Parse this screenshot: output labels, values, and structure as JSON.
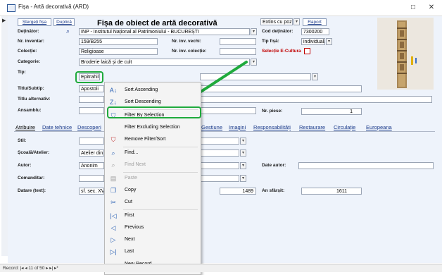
{
  "window": {
    "title": "Fișa - Artă decorativă (ARD)",
    "minimize": "□",
    "close": "✕"
  },
  "toolbar": {
    "delete_label": "Ștergeți fișa",
    "duplicate_label": "Duplică",
    "form_title": "Fișa de obiect de artă decorativă",
    "view_mode": "Extins cu poză",
    "report_label": "Raport"
  },
  "fields": {
    "detinator_label": "Deținător:",
    "detinator_value": "INP - Institutul Național al Patrimoniului - BUCUREȘTI",
    "cod_detinator_label": "Cod deținător:",
    "cod_detinator_value": "7300200",
    "nr_inventar_label": "Nr. inventar:",
    "nr_inventar_value": "159/B255",
    "nr_inv_vechi_label": "Nr. inv. vechi:",
    "nr_inv_vechi_value": "",
    "tip_fisa_label": "Tip fișă:",
    "tip_fisa_value": "individuală",
    "colectie_label": "Colecție:",
    "colectie_value": "Religioase",
    "nr_inv_colectie_label": "Nr. inv. colecție:",
    "nr_inv_colectie_value": "",
    "selectie_label": "Selecție E-Cultura",
    "categorie_label": "Categorie:",
    "categorie_value": "Broderie laică și de cult",
    "tip_label": "Tip:",
    "tip_value": "Epitrahil",
    "titlu_label": "Titlu/Subtip:",
    "titlu_value": "Apostoli",
    "titlu_alt_label": "Titlu alternativ:",
    "ansamblu_label": "Ansamblu:",
    "nr_piese_label": "Nr. piese:",
    "nr_piese_value": "1",
    "stil_label": "Stil:",
    "scoala_label": "Școală/Atelier:",
    "scoala_value": "Atelier din T",
    "autor_label": "Autor:",
    "autor_value": "Anonim",
    "date_autor_label": "Date autor:",
    "comanditar_label": "Comanditar:",
    "datare_label": "Datare (text):",
    "datare_value": "sf. sec. XV -",
    "datare_start": "1489",
    "an_sfarsit_label": "An sfârșit:",
    "an_sfarsit_value": "1611"
  },
  "tabs": [
    {
      "label": "Atribuire"
    },
    {
      "label": "Date tehnice"
    },
    {
      "label": "Descoperi"
    },
    {
      "label": "Gestiune"
    },
    {
      "label": "Imagini"
    },
    {
      "label": "Responsabilități"
    },
    {
      "label": "Restaurare"
    },
    {
      "label": "Circulație"
    },
    {
      "label": "Europeana"
    }
  ],
  "context_menu": {
    "items": [
      {
        "label": "Sort Ascending",
        "icon": "sort-ascending-icon",
        "glyph": "A↓",
        "enabled": true
      },
      {
        "label": "Sort Descending",
        "icon": "sort-descending-icon",
        "glyph": "Z↓",
        "enabled": true
      },
      {
        "label": "Filter By Selection",
        "icon": "filter-selection-icon",
        "glyph": "⛉",
        "enabled": true
      },
      {
        "label": "Filter Excluding Selection",
        "icon": "",
        "glyph": "",
        "enabled": true
      },
      {
        "label": "Remove Filter/Sort",
        "icon": "remove-filter-icon",
        "glyph": "⛉",
        "enabled": true
      },
      {
        "label": "Find...",
        "icon": "find-icon",
        "glyph": "⌕",
        "enabled": true
      },
      {
        "label": "Find Next",
        "icon": "find-next-icon",
        "glyph": "⌕",
        "enabled": false
      },
      {
        "label": "Paste",
        "icon": "paste-icon",
        "glyph": "▤",
        "enabled": false
      },
      {
        "label": "Copy",
        "icon": "copy-icon",
        "glyph": "❐",
        "enabled": true
      },
      {
        "label": "Cut",
        "icon": "cut-icon",
        "glyph": "✂",
        "enabled": true
      },
      {
        "label": "First",
        "icon": "first-icon",
        "glyph": "|◁",
        "enabled": true
      },
      {
        "label": "Previous",
        "icon": "previous-icon",
        "glyph": "◁",
        "enabled": true
      },
      {
        "label": "Next",
        "icon": "next-icon",
        "glyph": "▷",
        "enabled": true
      },
      {
        "label": "Last",
        "icon": "last-icon",
        "glyph": "▷|",
        "enabled": true
      },
      {
        "label": "New Record",
        "icon": "new-record-icon",
        "glyph": "▭",
        "enabled": true
      }
    ]
  },
  "status": {
    "record_nav": "Record: |◂ ◂ 11 of 50 ▸ ▸| ▸*"
  },
  "colors": {
    "highlight": "#1faa3c",
    "form_bg": "#eef3fb",
    "selection_label": "#c00000"
  }
}
